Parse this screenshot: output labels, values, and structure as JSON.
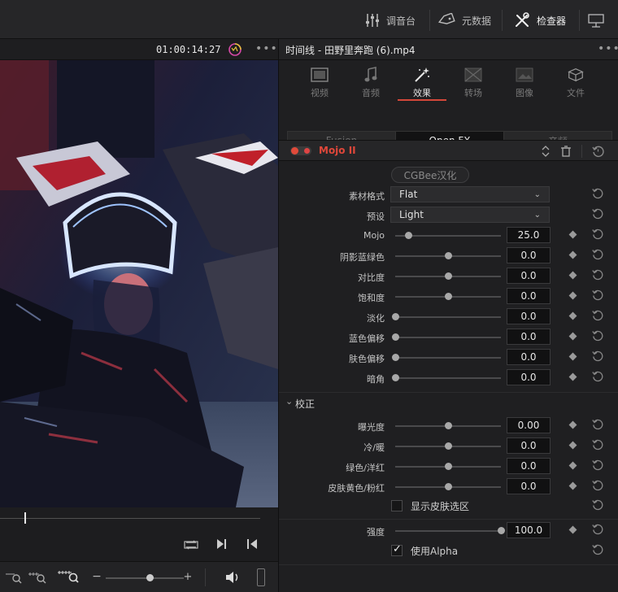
{
  "topbar": {
    "mixer_label": "调音台",
    "metadata_label": "元数据",
    "inspector_label": "检查器",
    "dots": "•••"
  },
  "viewer": {
    "timecode": "01:00:14:27",
    "more": "•••"
  },
  "inspector": {
    "title": "时间线 - 田野里奔跑 (6).mp4",
    "more": "•••",
    "tabs": [
      {
        "label": "视频",
        "icon": "film-icon"
      },
      {
        "label": "音频",
        "icon": "music-note-icon"
      },
      {
        "label": "效果",
        "icon": "magic-wand-icon"
      },
      {
        "label": "转场",
        "icon": "transition-icon"
      },
      {
        "label": "图像",
        "icon": "image-icon"
      },
      {
        "label": "文件",
        "icon": "file-icon"
      }
    ],
    "subtabs": [
      "Fusion",
      "Open FX",
      "音频"
    ],
    "effect_name": "Mojo II",
    "brand_button": "CGBee汉化",
    "format_label": "素材格式",
    "format_value": "Flat",
    "preset_label": "预设",
    "preset_value": "Light",
    "params": [
      {
        "label": "Mojo",
        "value": "25.0",
        "pos": 0.12
      },
      {
        "label": "阴影蓝绿色",
        "value": "0.0",
        "pos": 0.5
      },
      {
        "label": "对比度",
        "value": "0.0",
        "pos": 0.5
      },
      {
        "label": "饱和度",
        "value": "0.0",
        "pos": 0.5
      },
      {
        "label": "淡化",
        "value": "0.0",
        "pos": 0.0
      },
      {
        "label": "蓝色偏移",
        "value": "0.0",
        "pos": 0.0
      },
      {
        "label": "肤色偏移",
        "value": "0.0",
        "pos": 0.0
      },
      {
        "label": "暗角",
        "value": "0.0",
        "pos": 0.0
      }
    ],
    "correction_title": "校正",
    "correction_params": [
      {
        "label": "曝光度",
        "value": "0.00",
        "pos": 0.5
      },
      {
        "label": "冷/暖",
        "value": "0.0",
        "pos": 0.5
      },
      {
        "label": "绿色/洋红",
        "value": "0.0",
        "pos": 0.5
      },
      {
        "label": "皮肤黄色/粉红",
        "value": "0.0",
        "pos": 0.5
      }
    ],
    "show_skin_label": "显示皮肤选区",
    "strength_label": "强度",
    "strength_value": "100.0",
    "strength_pos": 1.0,
    "use_alpha_label": "使用Alpha",
    "use_alpha_checked": true,
    "show_skin_checked": false
  },
  "colors": {
    "accent_red": "#d4473a",
    "panel_bg": "#1f1f21"
  }
}
